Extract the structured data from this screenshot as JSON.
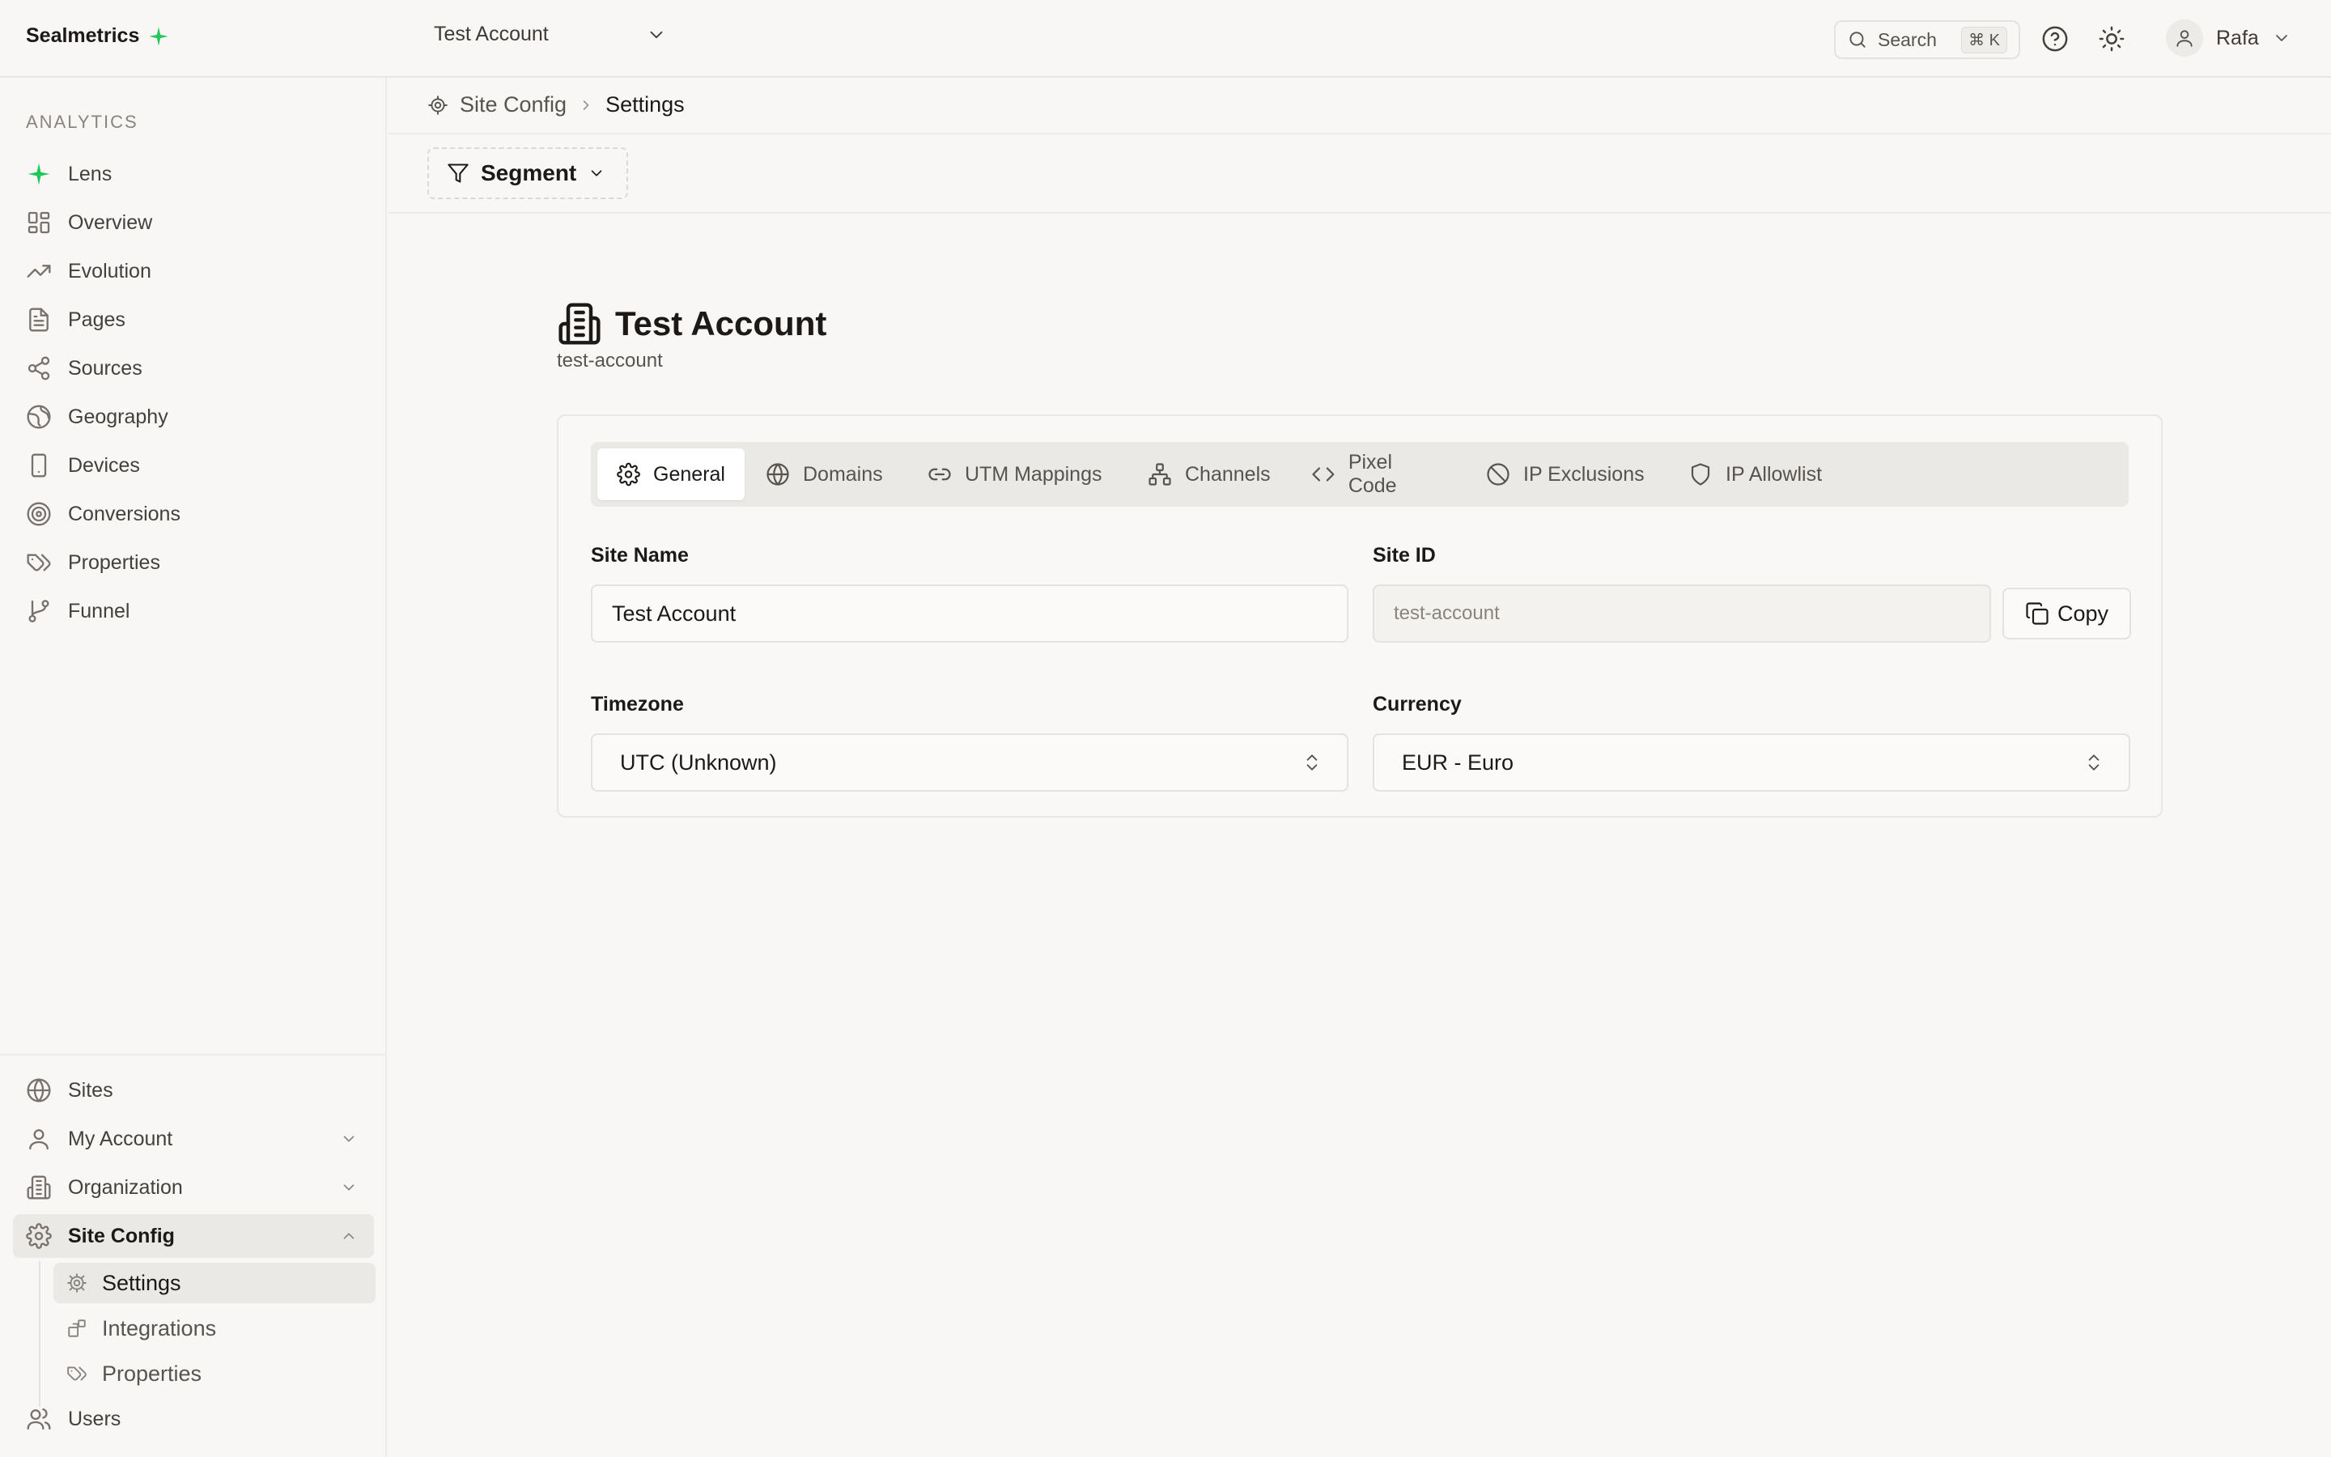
{
  "app": {
    "brand": "Sealmetrics"
  },
  "header": {
    "account": "Test Account",
    "search_label": "Search",
    "search_shortcut": "⌘ K",
    "user_name": "Rafa"
  },
  "sidebar": {
    "section_label": "ANALYTICS",
    "items": [
      {
        "label": "Lens",
        "icon": "sparkle-icon"
      },
      {
        "label": "Overview",
        "icon": "dashboard-icon"
      },
      {
        "label": "Evolution",
        "icon": "trending-up-icon"
      },
      {
        "label": "Pages",
        "icon": "file-icon"
      },
      {
        "label": "Sources",
        "icon": "share-icon"
      },
      {
        "label": "Geography",
        "icon": "globe-icon"
      },
      {
        "label": "Devices",
        "icon": "smartphone-icon"
      },
      {
        "label": "Conversions",
        "icon": "target-icon"
      },
      {
        "label": "Properties",
        "icon": "tags-icon"
      },
      {
        "label": "Funnel",
        "icon": "git-branch-icon"
      }
    ],
    "bottom_items": [
      {
        "label": "Sites"
      },
      {
        "label": "My Account"
      },
      {
        "label": "Organization"
      },
      {
        "label": "Site Config"
      }
    ],
    "site_config_sub": [
      {
        "label": "Settings"
      },
      {
        "label": "Integrations"
      },
      {
        "label": "Properties"
      }
    ],
    "users_label": "Users"
  },
  "breadcrumb": {
    "parent": "Site Config",
    "current": "Settings"
  },
  "segment_label": "Segment",
  "page": {
    "title": "Test Account",
    "slug": "test-account"
  },
  "tabs": [
    "General",
    "Domains",
    "UTM Mappings",
    "Channels",
    "Pixel Code",
    "IP Exclusions",
    "IP Allowlist"
  ],
  "form": {
    "site_name_label": "Site Name",
    "site_name_value": "Test Account",
    "site_id_label": "Site ID",
    "site_id_value": "test-account",
    "copy_label": "Copy",
    "timezone_label": "Timezone",
    "timezone_value": "UTC (Unknown)",
    "currency_label": "Currency",
    "currency_value": "EUR - Euro"
  },
  "colors": {
    "accent": "#22c55e",
    "background": "#f8f7f5",
    "border": "#e4e2de"
  }
}
